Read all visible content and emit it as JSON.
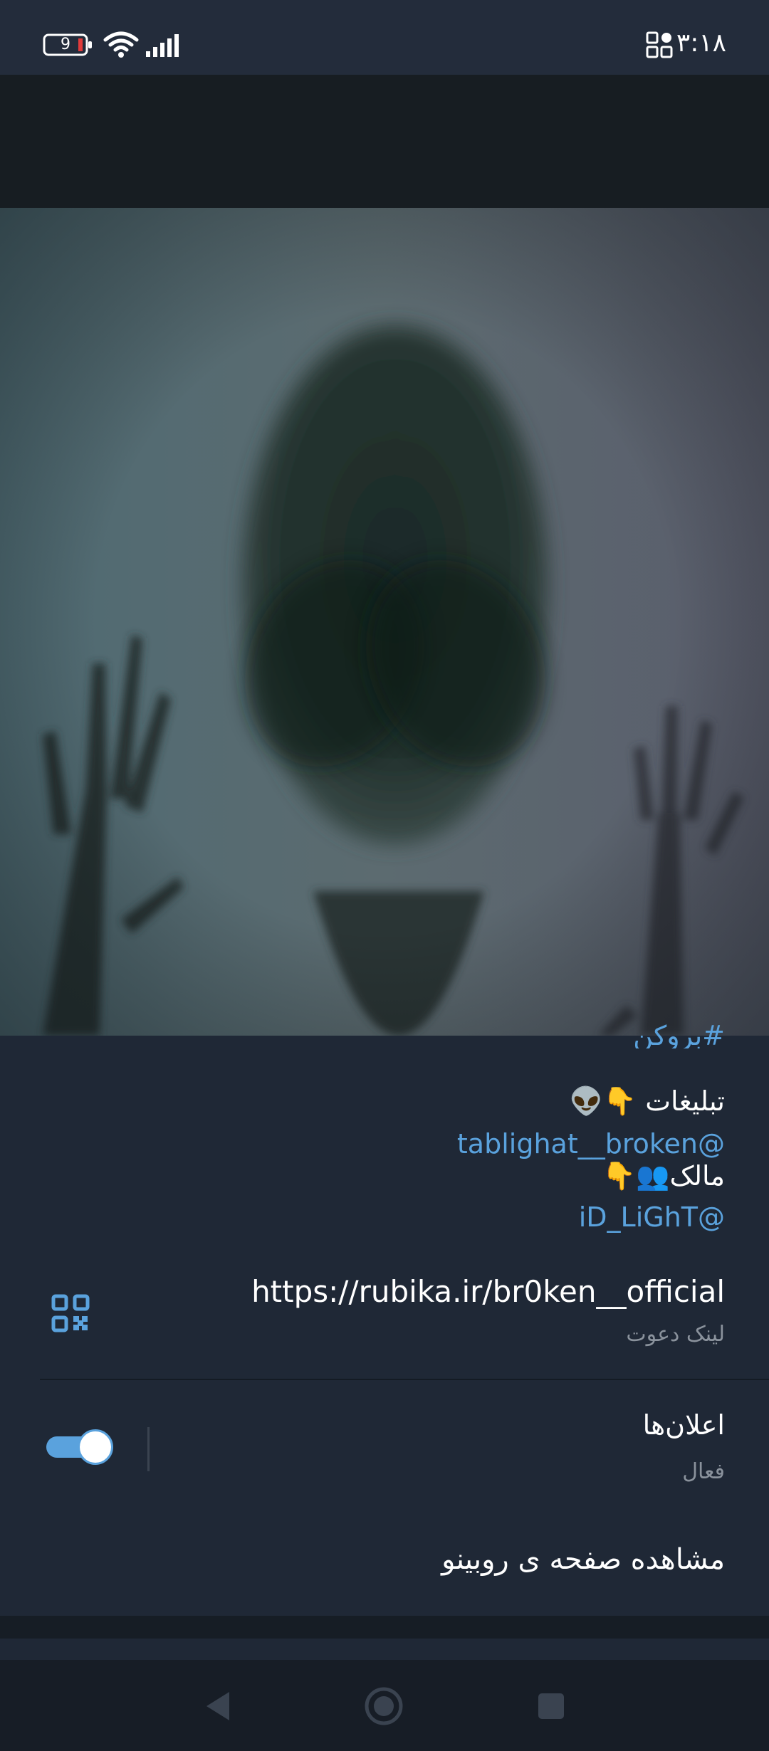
{
  "status_bar": {
    "time": "۳:۱۸",
    "battery_level": "9",
    "icons": [
      "apps-icon",
      "wifi-icon",
      "signal-icon",
      "battery-icon"
    ]
  },
  "profile": {
    "image": "alien-silhouette-photo"
  },
  "bio": {
    "hashtag_cut": "#بروکن",
    "ads_label": "تبلیغات 👇👽",
    "ads_id": "@tablighat__broken",
    "owner_label": "مالک👥👇",
    "owner_id": "@iD_LiGhT"
  },
  "invite": {
    "url": "https://rubika.ir/br0ken__official",
    "label": "لینک دعوت",
    "icon": "qr-code-icon"
  },
  "notifications": {
    "title": "اعلان‌ها",
    "status": "فعال",
    "enabled": true
  },
  "rubino": {
    "label": "مشاهده صفحه ی روبینو"
  },
  "colors": {
    "accent": "#5aa2dd",
    "background": "#1f2836",
    "secondary_text": "#8a929c"
  }
}
